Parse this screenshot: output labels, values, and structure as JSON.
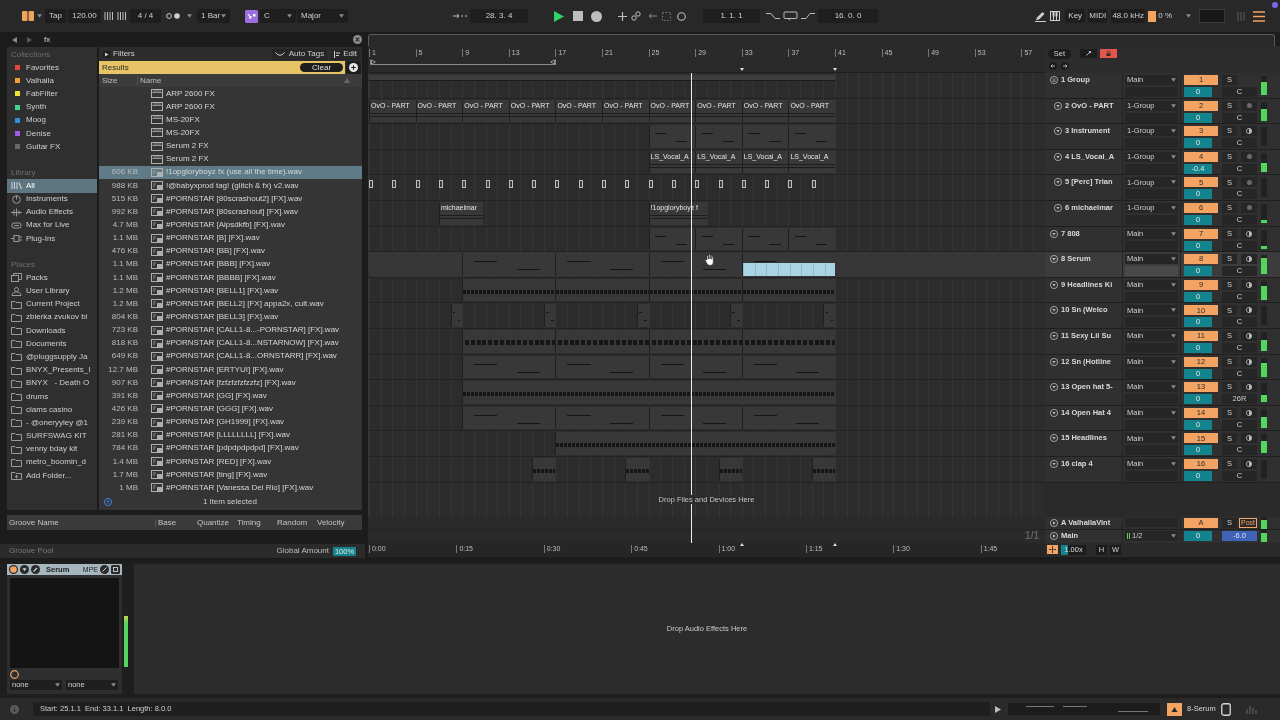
{
  "toolbar": {
    "tap": "Tap",
    "tempo": "120.00",
    "signature": "4 / 4",
    "quantize": "1 Bar",
    "key": "C",
    "scale": "Major",
    "position": "28. 3. 4",
    "loop_start": "1. 1. 1",
    "loop_length": "16. 0. 0",
    "key_button": "Key",
    "midi_button": "MIDI",
    "sample_rate": "48.0 kHz",
    "cpu": "0 %",
    "playing": true,
    "recording": false
  },
  "browser": {
    "search": "fx",
    "collections": {
      "title": "Collections",
      "items": [
        {
          "label": "Favorites",
          "color": "#e8453c",
          "selected": false
        },
        {
          "label": "Valhalla",
          "color": "#f0a030",
          "selected": false
        },
        {
          "label": "FabFilter",
          "color": "#f2e23a",
          "selected": false
        },
        {
          "label": "Synth",
          "color": "#3fd68a",
          "selected": false
        },
        {
          "label": "Moog",
          "color": "#2f8fe0",
          "selected": false
        },
        {
          "label": "Denise",
          "color": "#a45be6",
          "selected": false
        },
        {
          "label": "Guitar FX",
          "color": "#6a6a6a",
          "selected": false
        }
      ]
    },
    "library": {
      "title": "Library",
      "items": [
        {
          "label": "All",
          "selected": true
        },
        {
          "label": "Instruments",
          "selected": false
        },
        {
          "label": "Audio Effects",
          "selected": false
        },
        {
          "label": "Max for Live",
          "selected": false
        },
        {
          "label": "Plug-Ins",
          "selected": false
        }
      ]
    },
    "places": {
      "title": "Places",
      "items": [
        {
          "label": "Packs",
          "selected": false
        },
        {
          "label": "User Library",
          "selected": false
        },
        {
          "label": "Current Project",
          "selected": false
        },
        {
          "label": "zbierka zvukov bi",
          "selected": false
        },
        {
          "label": "Downloads",
          "selected": false
        },
        {
          "label": "Documents",
          "selected": false
        },
        {
          "label": "@pluggsupply Ja",
          "selected": false
        },
        {
          "label": "BNYX_Presents_I",
          "selected": false
        },
        {
          "label": "BNYX   - Death O",
          "selected": false
        },
        {
          "label": "drums",
          "selected": false
        },
        {
          "label": "clams casino",
          "selected": false
        },
        {
          "label": "- @oneryyley @1",
          "selected": false
        },
        {
          "label": "SURFSWAG KIT",
          "selected": false
        },
        {
          "label": "venny bday kit",
          "selected": false
        },
        {
          "label": "metro_boomin_d",
          "selected": false
        },
        {
          "label": "Add Folder...",
          "selected": false
        }
      ]
    },
    "filters": "Filters",
    "auto_tags": "Auto Tags",
    "edit": "Edit",
    "results": "Results",
    "clear": "Clear",
    "columns": [
      "Size",
      "Name"
    ],
    "rows": [
      {
        "kind": "preset",
        "name": "ARP 2600 FX",
        "selected": false
      },
      {
        "kind": "preset",
        "name": "ARP 2600 FX",
        "selected": false
      },
      {
        "kind": "preset",
        "name": "MS-20FX",
        "selected": false
      },
      {
        "kind": "preset",
        "name": "MS-20FX",
        "selected": false
      },
      {
        "kind": "preset",
        "name": "Serum 2 FX",
        "selected": false
      },
      {
        "kind": "preset",
        "name": "Serum 2 FX",
        "selected": false
      },
      {
        "kind": "audio",
        "size": "606 KB",
        "name": "!1opgloryboyz fx (use all the time).wav",
        "selected": true
      },
      {
        "kind": "audio",
        "size": "988 KB",
        "name": "!@babyxprod tag! (glitch & fx) v2.wav",
        "selected": false
      },
      {
        "kind": "audio",
        "size": "515 KB",
        "name": "#PORNSTAR [80scrashout2] [FX].wav",
        "selected": false
      },
      {
        "kind": "audio",
        "size": "992 KB",
        "name": "#PORNSTAR [80scrashout] [FX].wav",
        "selected": false
      },
      {
        "kind": "audio",
        "size": "4.7 MB",
        "name": "#PORNSTAR [Aipsdkfb] [FX].wav",
        "selected": false
      },
      {
        "kind": "audio",
        "size": "1.1 MB",
        "name": "#PORNSTAR [B] [FX].wav",
        "selected": false
      },
      {
        "kind": "audio",
        "size": "476 KB",
        "name": "#PORNSTAR [BB] [FX].wav",
        "selected": false
      },
      {
        "kind": "audio",
        "size": "1.1 MB",
        "name": "#PORNSTAR [BBB] [FX].wav",
        "selected": false
      },
      {
        "kind": "audio",
        "size": "1.1 MB",
        "name": "#PORNSTAR [BBBB] [FX].wav",
        "selected": false
      },
      {
        "kind": "audio",
        "size": "1.2 MB",
        "name": "#PORNSTAR [BELL1] [FX].wav",
        "selected": false
      },
      {
        "kind": "audio",
        "size": "1.2 MB",
        "name": "#PORNSTAR [BELL2] [FX] appa2x, cult.wav",
        "selected": false
      },
      {
        "kind": "audio",
        "size": "804 KB",
        "name": "#PORNSTAR [BELL3] [FX].wav",
        "selected": false
      },
      {
        "kind": "audio",
        "size": "723 KB",
        "name": "#PORNSTAR [CALL1-8...-PORNSTAR] [FX].wav",
        "selected": false
      },
      {
        "kind": "audio",
        "size": "818 KB",
        "name": "#PORNSTAR [CALL1-8...NSTARNOW] [FX].wav",
        "selected": false
      },
      {
        "kind": "audio",
        "size": "649 KB",
        "name": "#PORNSTAR [CALL1-8...ORNSTARR] [FX].wav",
        "selected": false
      },
      {
        "kind": "audio",
        "size": "12.7 MB",
        "name": "#PORNSTAR [ERTYUI] [FX].wav",
        "selected": false
      },
      {
        "kind": "audio",
        "size": "907 KB",
        "name": "#PORNSTAR [fzfzfzfzfzzfz] [FX].wav",
        "selected": false
      },
      {
        "kind": "audio",
        "size": "391 KB",
        "name": "#PORNSTAR [GG] [FX].wav",
        "selected": false
      },
      {
        "kind": "audio",
        "size": "426 KB",
        "name": "#PORNSTAR [GGG] [FX].wav",
        "selected": false
      },
      {
        "kind": "audio",
        "size": "239 KB",
        "name": "#PORNSTAR [GH1999] [FX].wav",
        "selected": false
      },
      {
        "kind": "audio",
        "size": "281 KB",
        "name": "#PORNSTAR [LLLLLLLL] [FX].wav",
        "selected": false
      },
      {
        "kind": "audio",
        "size": "784 KB",
        "name": "#PORNSTAR [pdpdpdpdpd] [FX].wav",
        "selected": false
      },
      {
        "kind": "audio",
        "size": "1.4 MB",
        "name": "#PORNSTAR [RED] [FX].wav",
        "selected": false
      },
      {
        "kind": "audio",
        "size": "1.7 MB",
        "name": "#PORNSTAR [ting] [FX].wav",
        "selected": false
      },
      {
        "kind": "audio",
        "size": "1 MB",
        "name": "#PORNSTAR [Vanessa Del Rio] [FX].wav",
        "selected": false
      }
    ],
    "footer": "1 item selected"
  },
  "groove_pool": {
    "columns": [
      "Groove Name",
      "Base",
      "Quantize",
      "Timing",
      "Random",
      "Velocity"
    ],
    "title": "Groove Pool",
    "global_amount_label": "Global Amount",
    "global_amount": "100%"
  },
  "arrangement": {
    "set": "Set",
    "bar_numbers": [
      "1",
      "5",
      "9",
      "13",
      "17",
      "21",
      "25",
      "29",
      "33",
      "37",
      "41",
      "45",
      "49",
      "53",
      "57"
    ],
    "tracks": [
      {
        "name": "1 Group",
        "kind": "group",
        "output": "Main",
        "number": "1",
        "active": true,
        "solo": {
          "label": "S",
          "on": false
        },
        "volume": "0",
        "pan": "C",
        "selected": false,
        "level": 0.7,
        "children": [
          {
            "name": "2 OvO - PART",
            "kind": "audio",
            "output": "1-Group",
            "number": "2",
            "active": true,
            "solo": {
              "label": "S",
              "on": false
            },
            "armed": false,
            "volume": "0",
            "pan": "C",
            "selected": false,
            "level": 0.6,
            "clips": [
              "OvO - PART",
              "OvO - PART",
              "OvO - PART",
              "OvO - PART",
              "OvO - PART",
              "OvO - PART",
              "OvO - PART",
              "OvO - PART",
              "OvO - PART",
              "OvO - PART"
            ]
          },
          {
            "name": "3 Instrument",
            "kind": "midi",
            "output": "1-Group",
            "number": "3",
            "active": true,
            "solo": {
              "label": "S",
              "on": false
            },
            "armed": false,
            "volume": "0",
            "pan": "C",
            "selected": false,
            "level": 0
          },
          {
            "name": "4 LS_Vocal_A",
            "kind": "audio",
            "output": "1-Group",
            "number": "4",
            "active": true,
            "solo": {
              "label": "S",
              "on": false
            },
            "armed": false,
            "volume": "-0.4",
            "pan": "C",
            "selected": false,
            "level": 0.45,
            "clips": [
              "LS_Vocal_A",
              "LS_Vocal_A",
              "LS_Vocal_A",
              "LS_Vocal_A"
            ]
          },
          {
            "name": "5 [Perc] Trian",
            "kind": "audio",
            "output": "1-Group",
            "number": "5",
            "active": true,
            "solo": {
              "label": "S",
              "on": false
            },
            "armed": false,
            "volume": "0",
            "pan": "C",
            "selected": false,
            "level": 0
          },
          {
            "name": "6 michaelmar",
            "kind": "audio",
            "output": "1-Group",
            "number": "6",
            "active": true,
            "solo": {
              "label": "S",
              "on": false
            },
            "armed": false,
            "volume": "0",
            "pan": "C",
            "selected": false,
            "level": 0.15,
            "clips": [
              "michaelmar",
              "!1opgloryboyz f"
            ]
          }
        ]
      },
      {
        "name": "7 808",
        "kind": "midi",
        "output": "Main",
        "number": "7",
        "active": true,
        "solo": {
          "label": "S",
          "on": false
        },
        "armed": false,
        "volume": "0",
        "pan": "C",
        "selected": false,
        "level": 0.15
      },
      {
        "name": "8 Serum",
        "kind": "midi",
        "output": "Main",
        "number": "8",
        "active": true,
        "solo": {
          "label": "S",
          "on": false
        },
        "armed": false,
        "volume": "0",
        "pan": "C",
        "selected": true,
        "level": 0.85
      },
      {
        "name": "9 Headlines Ki",
        "kind": "midi",
        "output": "Main",
        "number": "9",
        "active": true,
        "solo": {
          "label": "S",
          "on": false
        },
        "armed": false,
        "volume": "0",
        "pan": "C",
        "selected": false,
        "level": 0.75
      },
      {
        "name": "10 Sn (Welco",
        "kind": "midi",
        "output": "Main",
        "number": "10",
        "active": true,
        "solo": {
          "label": "S",
          "on": false
        },
        "armed": false,
        "volume": "0",
        "pan": "C",
        "selected": false,
        "level": 0
      },
      {
        "name": "11 Sexy Lil Su",
        "kind": "midi",
        "output": "Main",
        "number": "11",
        "active": true,
        "solo": {
          "label": "S",
          "on": false
        },
        "armed": false,
        "volume": "0",
        "pan": "C",
        "selected": false,
        "level": 0.6
      },
      {
        "name": "12 Sn (Hotline",
        "kind": "midi",
        "output": "Main",
        "number": "12",
        "active": true,
        "solo": {
          "label": "S",
          "on": false
        },
        "armed": false,
        "volume": "0",
        "pan": "C",
        "selected": false,
        "level": 0.7
      },
      {
        "name": "13 Open hat 5-",
        "kind": "midi",
        "output": "Main",
        "number": "13",
        "active": true,
        "solo": {
          "label": "S",
          "on": false
        },
        "armed": false,
        "volume": "0",
        "pan": "26R",
        "selected": false,
        "level": 0.35
      },
      {
        "name": "14 Open Hat 4",
        "kind": "midi",
        "output": "Main",
        "number": "14",
        "active": true,
        "solo": {
          "label": "S",
          "on": false
        },
        "armed": false,
        "volume": "0",
        "pan": "C",
        "selected": false,
        "level": 0.55
      },
      {
        "name": "15 Headlines",
        "kind": "midi",
        "output": "Main",
        "number": "15",
        "active": true,
        "solo": {
          "label": "S",
          "on": false
        },
        "armed": false,
        "volume": "0",
        "pan": "C",
        "selected": false,
        "level": 0.65
      },
      {
        "name": "16 clap 4",
        "kind": "midi",
        "output": "Main",
        "number": "16",
        "active": true,
        "solo": {
          "label": "S",
          "on": false
        },
        "armed": false,
        "volume": "0",
        "pan": "C",
        "selected": false,
        "level": 0
      }
    ],
    "drop_hint": "Drop Files and Devices Here",
    "returns": [
      {
        "name": "A ValhallaVint",
        "letter": "A",
        "active": true,
        "solo": {
          "label": "S",
          "on": false
        },
        "mode": "Post",
        "level": 0.7
      }
    ],
    "main": {
      "name": "Main",
      "output": "1/2",
      "volume": "0",
      "value_2": "-6.0",
      "level": 0.75
    },
    "page": "1/1",
    "time_labels": [
      "0:00",
      "0:15",
      "0:30",
      "0:45",
      "1:00",
      "1:15",
      "1:30",
      "1:45"
    ],
    "zoom": "1.00x",
    "h_button": "H",
    "w_button": "W"
  },
  "device": {
    "name": "Serum",
    "badge": "MPE",
    "on": true,
    "selectors": [
      "none",
      "none"
    ],
    "level": 0.9,
    "drop_hint": "Drop Audio Effects Here"
  },
  "status_bar": {
    "text": "Start: 25.1.1  End: 33.1.1  Length: 8.0.0",
    "track": "8-Serum"
  }
}
